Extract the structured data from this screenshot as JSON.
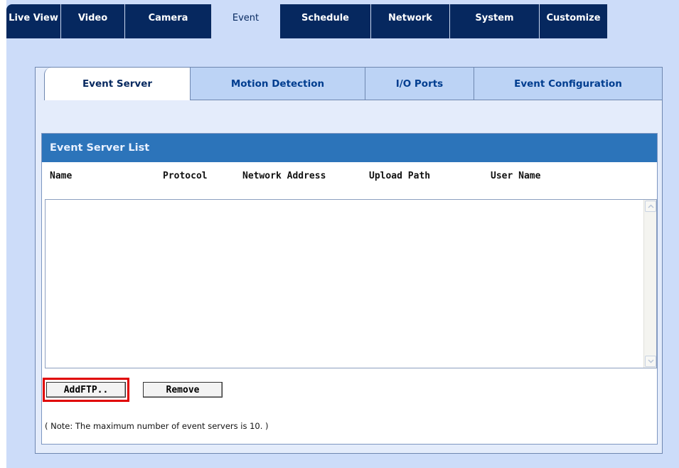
{
  "top_tabs": [
    {
      "label": "Live View",
      "active": false
    },
    {
      "label": "Video",
      "active": false
    },
    {
      "label": "Camera",
      "active": false
    },
    {
      "label": "Event",
      "active": true
    },
    {
      "label": "Schedule",
      "active": false
    },
    {
      "label": "Network",
      "active": false
    },
    {
      "label": "System",
      "active": false
    },
    {
      "label": "Customize",
      "active": false
    }
  ],
  "sub_tabs": [
    {
      "label": "Event Server",
      "active": true
    },
    {
      "label": "Motion Detection",
      "active": false
    },
    {
      "label": "I/O Ports",
      "active": false
    },
    {
      "label": "Event Configuration",
      "active": false
    }
  ],
  "event_server_list": {
    "title": "Event Server List",
    "columns": [
      "Name",
      "Protocol",
      "Network Address",
      "Upload Path",
      "User Name"
    ],
    "rows": []
  },
  "buttons": {
    "add_ftp": "AddFTP..",
    "remove": "Remove"
  },
  "note": "( Note: The maximum number of event servers is 10. )",
  "colors": {
    "nav_dark": "#06285f",
    "page_bg": "#ccdcf9",
    "list_header": "#2c74ba",
    "subtab_bg": "#bcd3f5",
    "highlight": "#e00000"
  }
}
